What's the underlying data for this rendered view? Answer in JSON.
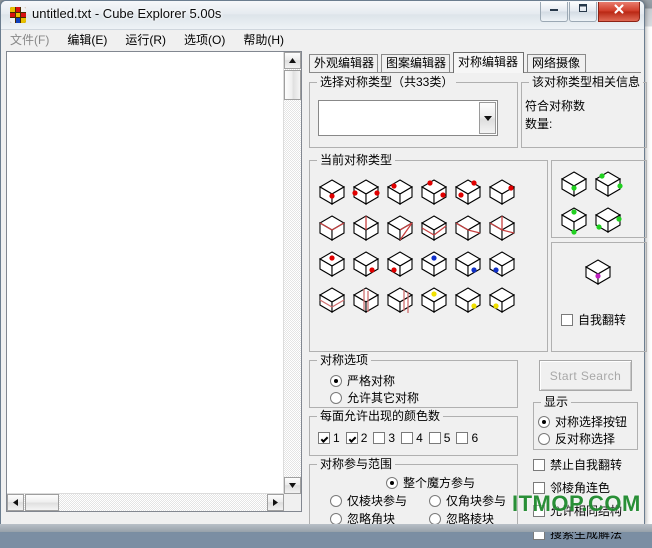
{
  "background_window": {
    "title_blurred": "unknown_blurred_title",
    "icon": "app-icon"
  },
  "window": {
    "title": "untitled.txt - Cube Explorer 5.00s",
    "icon_name": "rubiks-cube-icon",
    "controls": {
      "minimize": "minimize-button",
      "maximize": "maximize-button",
      "close": "close-button"
    }
  },
  "menubar": {
    "items": [
      {
        "label": "文件(F)",
        "dim": true
      },
      {
        "label": "编辑(E)",
        "dim": false
      },
      {
        "label": "运行(R)",
        "dim": false
      },
      {
        "label": "选项(O)",
        "dim": false
      },
      {
        "label": "帮助(H)",
        "dim": false
      }
    ]
  },
  "editor": {
    "content": "",
    "scrollbars": {
      "vertical": "vertical-scrollbar",
      "horizontal": "horizontal-scrollbar"
    }
  },
  "tabs": [
    {
      "label": "外观编辑器",
      "active": false
    },
    {
      "label": "图案编辑器",
      "active": false
    },
    {
      "label": "对称编辑器",
      "active": true
    },
    {
      "label": "网络摄像",
      "active": false
    }
  ],
  "select_symmetry_group": {
    "label": "选择对称类型（共33类）",
    "combo_value": "",
    "arrow_icon": "chevron-down-icon"
  },
  "info_group": {
    "label": "该对称类型相关信息",
    "lines": [
      "符合对称数",
      "数量:"
    ]
  },
  "current_symmetry_group": {
    "label": "当前对称类型",
    "rows": [
      [
        {
          "marker": "dot",
          "color": "#e00000",
          "pos": "front-center"
        },
        {
          "marker": "dot",
          "color": "#e00000",
          "pos": "left-right"
        },
        {
          "marker": "dot",
          "color": "#e00000",
          "pos": "top-left"
        },
        {
          "marker": "dot",
          "color": "#e00000",
          "pos": "top-left-bottom-right"
        },
        {
          "marker": "dot",
          "color": "#e00000",
          "pos": "top-right-bottom-left"
        },
        {
          "marker": "dot",
          "color": "#e00000",
          "pos": "top-right"
        }
      ],
      [
        {
          "marker": "line",
          "color": "#c84040",
          "pos": "horizontal-top"
        },
        {
          "marker": "line",
          "color": "#c84040",
          "pos": "vertical-center"
        },
        {
          "marker": "line",
          "color": "#c84040",
          "pos": "diagonal-right"
        },
        {
          "marker": "line",
          "color": "#c84040",
          "pos": "diagonal-flat"
        },
        {
          "marker": "line",
          "color": "#c84040",
          "pos": "diagonal-left"
        },
        {
          "marker": "line",
          "color": "#c84040",
          "pos": "diagonal-cross"
        }
      ],
      [
        {
          "marker": "dot",
          "color": "#e00000",
          "pos": "top-center"
        },
        {
          "marker": "dot",
          "color": "#e00000",
          "pos": "right-face"
        },
        {
          "marker": "dot",
          "color": "#e00000",
          "pos": "left-face"
        },
        {
          "marker": "dot",
          "color": "#1030c8",
          "pos": "top-center"
        },
        {
          "marker": "dot",
          "color": "#1030c8",
          "pos": "right-face"
        },
        {
          "marker": "dot",
          "color": "#1030c8",
          "pos": "left-face"
        }
      ],
      [
        {
          "marker": "line",
          "color": "#d07070",
          "pos": "band-horizontal"
        },
        {
          "marker": "line",
          "color": "#d07070",
          "pos": "band-vertical"
        },
        {
          "marker": "line",
          "color": "#d07070",
          "pos": "band-vertical-right"
        },
        {
          "marker": "dot",
          "color": "#f0e000",
          "pos": "top-center"
        },
        {
          "marker": "dot",
          "color": "#f0e000",
          "pos": "right-face"
        },
        {
          "marker": "dot",
          "color": "#f0e000",
          "pos": "left-face"
        }
      ]
    ],
    "side_cubes": [
      {
        "marker": "dot",
        "color": "#20d020",
        "pos": "front-center"
      },
      {
        "marker": "dot",
        "color": "#20d020",
        "pos": "top-left-right"
      },
      {
        "marker": "dot",
        "color": "#20d020",
        "pos": "top-bottom"
      },
      {
        "marker": "dot",
        "color": "#20d020",
        "pos": "right-left"
      }
    ],
    "self_flip_cube": {
      "marker": "dot",
      "color": "#c020c0",
      "pos": "front-center"
    },
    "self_flip_checkbox": {
      "label": "自我翻转",
      "checked": false
    }
  },
  "symmetry_options": {
    "label": "对称选项",
    "radios": [
      {
        "label": "严格对称",
        "checked": true
      },
      {
        "label": "允许其它对称",
        "checked": false
      }
    ]
  },
  "colors_per_face": {
    "label": "每面允许出现的颜色数",
    "items": [
      {
        "label": "1",
        "checked": true
      },
      {
        "label": "2",
        "checked": true
      },
      {
        "label": "3",
        "checked": false
      },
      {
        "label": "4",
        "checked": false
      },
      {
        "label": "5",
        "checked": false
      },
      {
        "label": "6",
        "checked": false
      }
    ]
  },
  "participation_range": {
    "label": "对称参与范围",
    "radios": [
      {
        "label": "整个魔方参与",
        "checked": true
      },
      {
        "label": "仅棱块参与",
        "checked": false
      },
      {
        "label": "仅角块参与",
        "checked": false
      },
      {
        "label": "忽略角块",
        "checked": false
      },
      {
        "label": "忽略棱块",
        "checked": false
      }
    ]
  },
  "start_search": {
    "label": "Start Search",
    "enabled": false
  },
  "display_group": {
    "label": "显示",
    "radios": [
      {
        "label": "对称选择按钮",
        "checked": true
      },
      {
        "label": "反对称选择",
        "checked": false
      }
    ]
  },
  "extra_checkboxes": [
    {
      "label": "禁止自我翻转",
      "checked": false
    },
    {
      "label": "邻棱角连色",
      "checked": false
    },
    {
      "label": "允许相同结构",
      "checked": false
    },
    {
      "label": "搜索生成解法",
      "checked": false
    }
  ],
  "watermark": {
    "text": "ITMOP.COM",
    "color": "#1f8a2e"
  }
}
